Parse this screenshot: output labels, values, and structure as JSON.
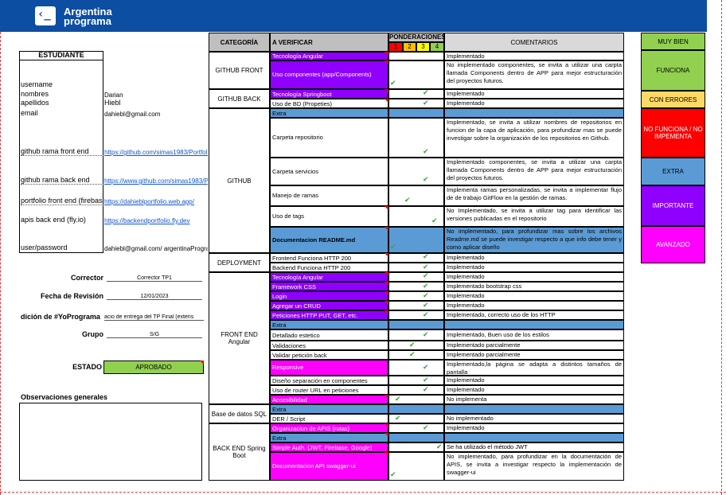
{
  "header": {
    "brand_line1": "Argentina",
    "brand_line2": "programa",
    "logo_glyph": "‹_"
  },
  "student": {
    "title": "ESTUDIANTE",
    "fields": [
      {
        "label": "username",
        "value": ""
      },
      {
        "label": "nombres",
        "value": "Darian"
      },
      {
        "label": "apellidos",
        "value": "Hiebl"
      },
      {
        "label": "email",
        "value": "dahiebl@gmail.com"
      },
      {
        "label": "github rama front end",
        "value": "https://github.com/simas1983/Portfolio"
      },
      {
        "label": "github rama back end",
        "value": "https://www.github.com/simas1983/Portfolio"
      },
      {
        "label": "portfolio front end (firebase)",
        "value": "https://dahieblportfolio.web.app/"
      },
      {
        "label": "apis back end (fly.io)",
        "value": "https://backendportfolio.fly.dev"
      },
      {
        "label": "user/password",
        "value": "dahiebl@gmail.com/ argentinaPrograma"
      }
    ],
    "corrector_label": "Corrector",
    "corrector_value": "Corrector TP1",
    "fecha_label": "Fecha de Revisión",
    "fecha_value": "12/01/2023",
    "edicion_label": "dición de #YoPrograma",
    "edicion_value": "acio de entrega del TP Final (extens",
    "grupo_label": "Grupo",
    "grupo_value": "S/G",
    "estado_label": "ESTADO",
    "estado_value": "APROBADO",
    "obs_label": "Observaciones generales"
  },
  "table": {
    "h_categoria": "CATEGORÍA",
    "h_verificar": "A VERIFICAR",
    "h_ponderaciones": "PONDERACIONES",
    "h_p": [
      "1",
      "2",
      "3",
      "4"
    ],
    "h_comentarios": "COMENTARIOS",
    "categories": [
      "GITHUB FRONT",
      "GITHUB BACK",
      "GITHUB",
      "DEPLOYMENT",
      "FRONT END Angular",
      "Base de datos SQL",
      "BACK END Spring Boot"
    ],
    "rows": [
      {
        "item": "Tecnología Angular",
        "comment": "Implementado"
      },
      {
        "item": "Uso componentes (app/Components)",
        "comment": "No implementado componentes, se invita a utilizar una carpta llamada Components dentro de APP para mejor estructuración del proyectos futuros."
      },
      {
        "item": "Tecnología Springboot",
        "comment": "Implementado"
      },
      {
        "item": "Uso de BD (Propeties)",
        "comment": "Implementado"
      },
      {
        "item": "Extra",
        "comment": ""
      },
      {
        "item": "Carpeta repositorio",
        "comment": "Implementado, se invita a utilizar nombres de repositorios en funcion de la capa de aplicación, para profundizar mas se puede investigar sobre la organización de los repositorios en Github."
      },
      {
        "item": "Carpeta servicios",
        "comment": "Implementado componentes, se invita a utilizar una carpta llamada Components dentro de APP para mejor estructuración del proyectos futuros."
      },
      {
        "item": "Manejo de ramas",
        "comment": "Implementa ramas personalizadas, se invita a implementar flujo de de trabajo GitFlow en la gestión de ramas."
      },
      {
        "item": "Uso de tags",
        "comment": "No Implementado, se invita a utilizar tag para identificar las versiones publicadas en el repositorio"
      },
      {
        "item": "Documentacion README.md",
        "comment": "No implementado, para profundizar mas sobre los archivos Readme.md se puede investigar respecto a que info debe tener y como aplicar diseño"
      },
      {
        "item": "Frontend Funciona HTTP 200",
        "comment": "Implementado"
      },
      {
        "item": "Backend Funciona HTTP 200",
        "comment": "Implementado"
      },
      {
        "item": "Tecnología Angular",
        "comment": "Implementado"
      },
      {
        "item": "Framework CSS",
        "comment": "Implementado bootstrap css"
      },
      {
        "item": "Login",
        "comment": "Implementado"
      },
      {
        "item": "Agregar un  CRUD",
        "comment": "Implementado"
      },
      {
        "item": "Peticiones HTTP PUT, GET, etc.",
        "comment": "Implementado, correcto uso de los HTTP"
      },
      {
        "item": "Extra",
        "comment": ""
      },
      {
        "item": "Detallado estetico",
        "comment": "Implementado, Buen uso de los estilos"
      },
      {
        "item": "Validaciones",
        "comment": "Implementado parcialmente"
      },
      {
        "item": "Validar petición back",
        "comment": "Implementado parcialmente"
      },
      {
        "item": "Responsive",
        "comment": "Implementado,la página se adapta a distintos tamaños de pantalla"
      },
      {
        "item": "Diseño separación en componentes",
        "comment": "Implementado"
      },
      {
        "item": "Uso de router URL en peticiones",
        "comment": "Implementado"
      },
      {
        "item": "Accesibilidad",
        "comment": "No implementa"
      },
      {
        "item": "Extra",
        "comment": ""
      },
      {
        "item": "DER / Script",
        "comment": "No implementado"
      },
      {
        "item": "Organizacion de APIS (rutas)",
        "comment": "Implementado"
      },
      {
        "item": "Extra",
        "comment": ""
      },
      {
        "item": "Simple Auth. (JWT, Firebase, Google)",
        "comment": "Se ha utilizado el método JWT"
      },
      {
        "item": "Documentacion API swagger-ui",
        "comment": "No implementado, para profundizar en la documentación de APIS, se invita a investigar respecto la implementación de swagger-ui"
      }
    ]
  },
  "legend": [
    "MUY BIEN",
    "FUNCIONA",
    "CON ERRORES",
    "NO FUNCIONA / NO IMPEMENTA",
    "EXTRA",
    "IMPORTANTE",
    "AVANZADO"
  ],
  "colors": {
    "header": "#0b4ea2",
    "purple": "#8f00ff",
    "magenta": "#ff00ff",
    "blue": "#5b9bd5",
    "green": "#92d050",
    "yellow": "#ffd966",
    "red": "#ff0000",
    "check": "#3aa33a"
  }
}
